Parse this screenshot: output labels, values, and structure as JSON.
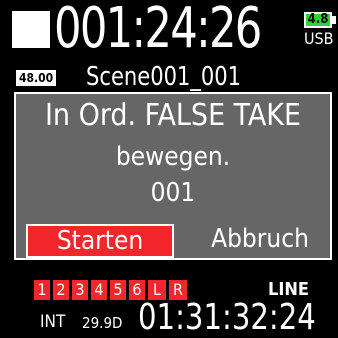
{
  "status": {
    "timecode": "001:24:26",
    "battery_level": "4.8",
    "usb_label": "USB"
  },
  "scene": {
    "fps_badge": "48.00",
    "name": "Scene001_001"
  },
  "dialog": {
    "line1": "In Ord. FALSE TAKE",
    "line2": "bewegen.",
    "line3": "001",
    "start_label": "Starten",
    "cancel_label": "Abbruch"
  },
  "tracks": {
    "items": [
      "1",
      "2",
      "3",
      "4",
      "5",
      "6",
      "L",
      "R"
    ],
    "line_label": "LINE"
  },
  "footer": {
    "int_label": "INT",
    "fps_label": "29.9D",
    "timecode": "01:31:32:24"
  },
  "colors": {
    "record_red": "#f3262b",
    "battery_green": "#2fd23a",
    "dialog_gray": "#666666"
  }
}
